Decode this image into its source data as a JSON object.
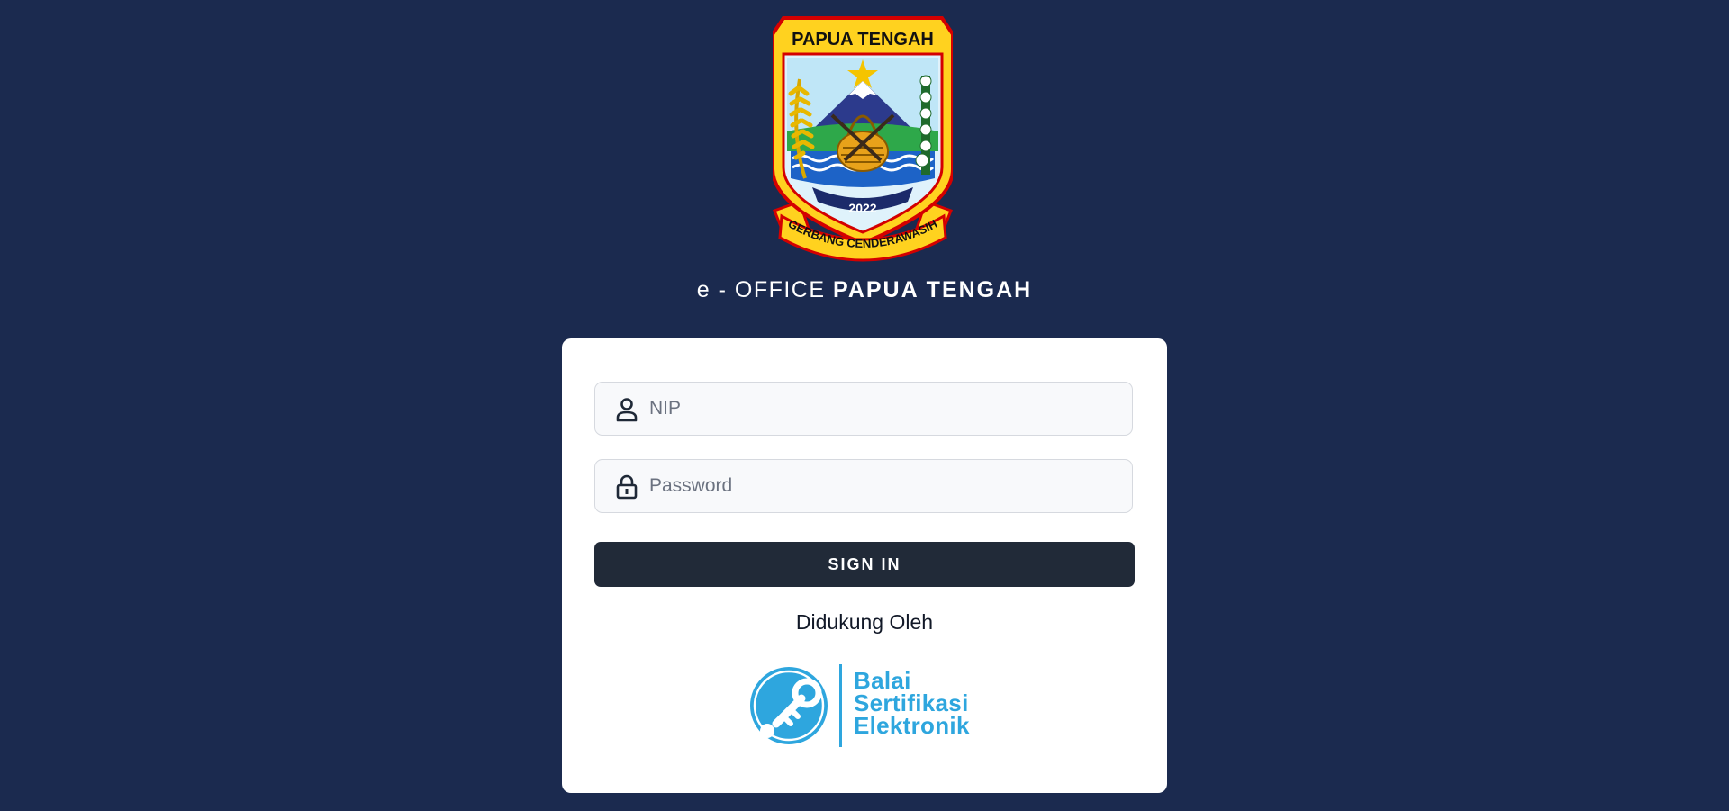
{
  "emblem": {
    "top_text": "PAPUA TENGAH",
    "year": "2022",
    "motto": "GERBANG CENDERAWASIH"
  },
  "header": {
    "title_prefix": "e - OFFICE",
    "title_name": "PAPUA TENGAH"
  },
  "login": {
    "nip_placeholder": "NIP",
    "password_placeholder": "Password",
    "signin_label": "SIGN IN",
    "support_label": "Didukung Oleh"
  },
  "bse": {
    "line1": "Balai",
    "line2": "Sertifikasi",
    "line3": "Elektronik"
  },
  "colors": {
    "background": "#1b2a4f",
    "button": "#212a38",
    "bse_blue": "#2ea6de"
  },
  "icons": {
    "nip": "user-icon",
    "password": "lock-icon"
  }
}
